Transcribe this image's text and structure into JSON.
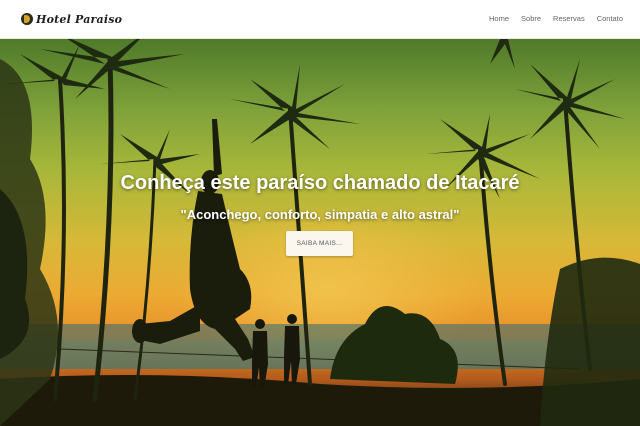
{
  "brand": {
    "name": "Hotel Paraiso"
  },
  "nav": {
    "items": [
      {
        "label": "Home"
      },
      {
        "label": "Sobre"
      },
      {
        "label": "Reservas"
      },
      {
        "label": "Contato"
      }
    ]
  },
  "hero": {
    "title": "Conheça este paraíso chamado de Itacaré",
    "subtitle": "\"Aconchego, conforto, simpatia e alto astral\"",
    "cta_label": "SAIBA MAIS..."
  },
  "colors": {
    "navbar_bg": "#ffffff",
    "nav_text": "#666666",
    "hero_text": "#ffffff",
    "cta_bg": "#fbf7ef",
    "brand_accent": "#d4a42a"
  },
  "icons": {
    "brand_logo": "hotel-logo-icon"
  }
}
